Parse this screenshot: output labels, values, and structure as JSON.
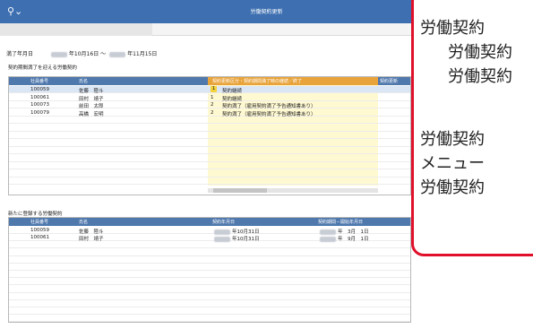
{
  "app": {
    "search_icon": "search-icon",
    "title": "労働契約更新"
  },
  "period": {
    "label": "満了年月日",
    "from": "年10月16日",
    "separator": "～",
    "to": "年11月15日"
  },
  "expiring": {
    "title": "契約期間満了を迎える労働契約",
    "columns": [
      "社員番号",
      "氏名",
      "契約更新区分・契約期間満了時の継続／終了",
      "契約更新"
    ],
    "rows": [
      {
        "id": "100059",
        "name": "佐藤　陸斗",
        "code": "1",
        "status": "契約継続",
        "selected": true
      },
      {
        "id": "100061",
        "name": "田村　靖子",
        "code": "1",
        "status": "契約継続",
        "selected": false
      },
      {
        "id": "100073",
        "name": "前田　太郎",
        "code": "2",
        "status": "契約満了（雇用契約満了予告通知書あり）",
        "selected": false
      },
      {
        "id": "100079",
        "name": "高橋　宏明",
        "code": "2",
        "status": "契約満了（雇用契約満了予告通知書あり）",
        "selected": false
      }
    ]
  },
  "newly": {
    "title": "新たに登録する労働契約",
    "columns": [
      "社員番号",
      "氏名",
      "契約年月日",
      "契約期間－開始年月日"
    ],
    "rows": [
      {
        "id": "100059",
        "name": "佐藤　陸斗",
        "date": "年10月31日",
        "start": "年　3月　1日"
      },
      {
        "id": "100061",
        "name": "田村　靖子",
        "date": "年10月31日",
        "start": "年　9月　1日"
      }
    ]
  },
  "callout": {
    "lines": [
      "労働契約",
      "労働契約",
      "労働契約",
      "労働契約",
      "メニュー",
      "労働契約"
    ]
  }
}
